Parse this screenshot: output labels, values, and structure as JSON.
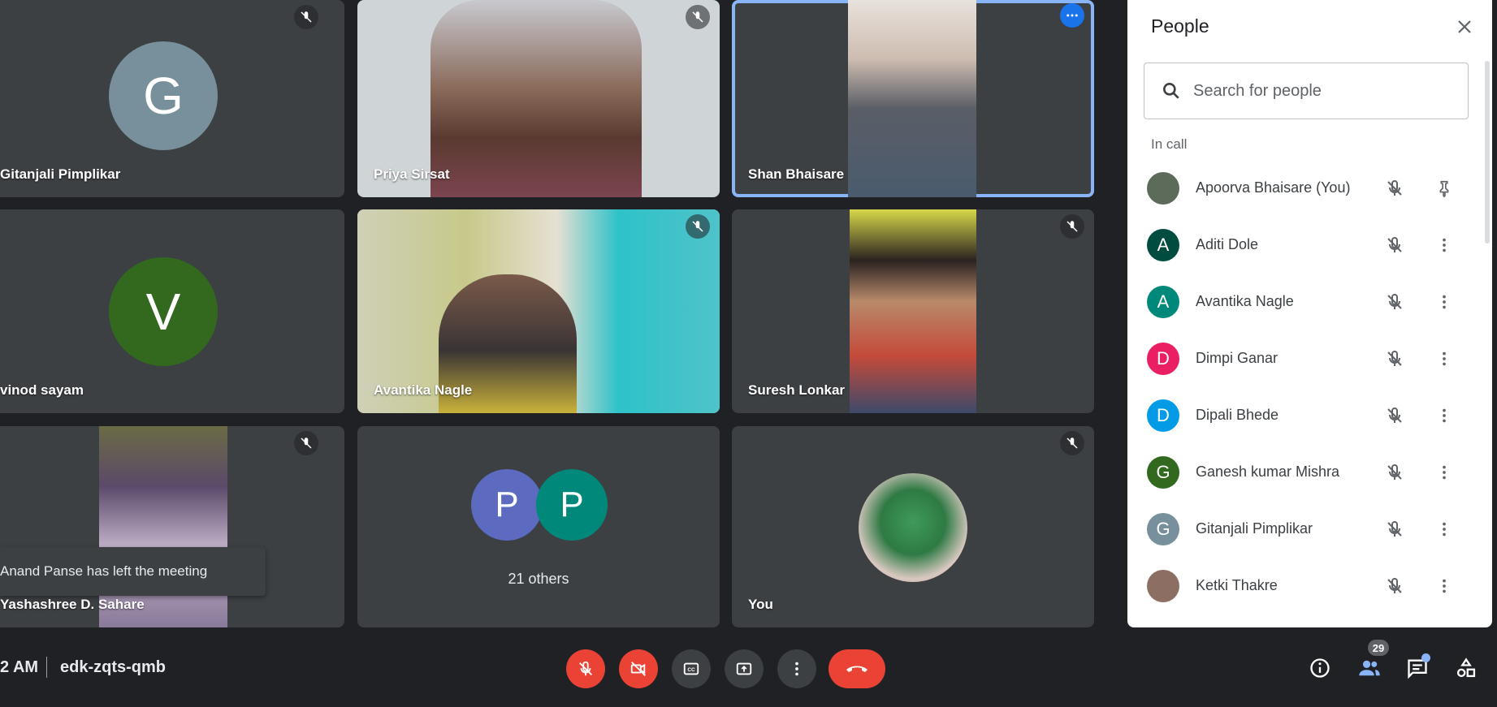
{
  "tiles": [
    {
      "name": "Gitanjali Pimplikar",
      "initial": "G",
      "avatar_color": "#78909c"
    },
    {
      "name": "Priya Sirsat"
    },
    {
      "name": "Shan Bhaisare"
    },
    {
      "name": "vinod sayam",
      "initial": "V",
      "avatar_color": "#33691e"
    },
    {
      "name": "Avantika Nagle"
    },
    {
      "name": "Suresh Lonkar"
    },
    {
      "name": "Yashashree D. Sahare"
    },
    {
      "others_label": "21 others",
      "initials": [
        "P",
        "P"
      ],
      "colors": [
        "#5c6bc0",
        "#00897b"
      ]
    },
    {
      "name": "You"
    }
  ],
  "toast": "Anand Panse has left the meeting",
  "bottom_bar": {
    "time": "2 AM",
    "meeting_code": "edk-zqts-qmb",
    "participant_count": "29"
  },
  "panel": {
    "title": "People",
    "search_placeholder": "Search for people",
    "section": "In call",
    "people": [
      {
        "name": "Apoorva Bhaisare (You)",
        "initial": "",
        "color": "#5d6b5a"
      },
      {
        "name": "Aditi Dole",
        "initial": "A",
        "color": "#004d40"
      },
      {
        "name": "Avantika Nagle",
        "initial": "A",
        "color": "#00897b"
      },
      {
        "name": "Dimpi Ganar",
        "initial": "D",
        "color": "#e91e63"
      },
      {
        "name": "Dipali Bhede",
        "initial": "D",
        "color": "#039be5"
      },
      {
        "name": "Ganesh kumar Mishra",
        "initial": "G",
        "color": "#33691e"
      },
      {
        "name": "Gitanjali Pimplikar",
        "initial": "G",
        "color": "#78909c"
      },
      {
        "name": "Ketki Thakre",
        "initial": "",
        "color": "#8d6e63"
      }
    ]
  }
}
